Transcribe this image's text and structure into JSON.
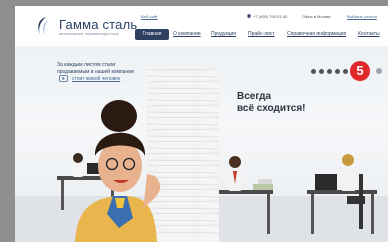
{
  "colors": {
    "brand": "#2e3f62",
    "accent": "#e1282a",
    "background": "#8f8f8f"
  },
  "header": {
    "logo_name": "Гамма сталь",
    "logo_tagline": "металлопрокат, нержавеющая сталь",
    "top_links": {
      "email": "Веб-сайт",
      "phone": "+7 (495) 795-01-00",
      "office": "Офис в Москве",
      "branch": "Выбрать регион"
    },
    "nav": [
      {
        "label": "Главная",
        "active": true
      },
      {
        "label": "О компании"
      },
      {
        "label": "Продукция"
      },
      {
        "label": "Прайс-лист"
      },
      {
        "label": "Справочная информация"
      },
      {
        "label": "Контакты"
      }
    ]
  },
  "banner": {
    "promo_line1": "За каждым листом стали",
    "promo_line2": "продаваемым в нашей компании",
    "promo_link": "стоит живой человек",
    "tagline_line1": "Всегда",
    "tagline_line2": "всё сходится!",
    "slide_number": "5",
    "slides_total_visible": 5
  }
}
